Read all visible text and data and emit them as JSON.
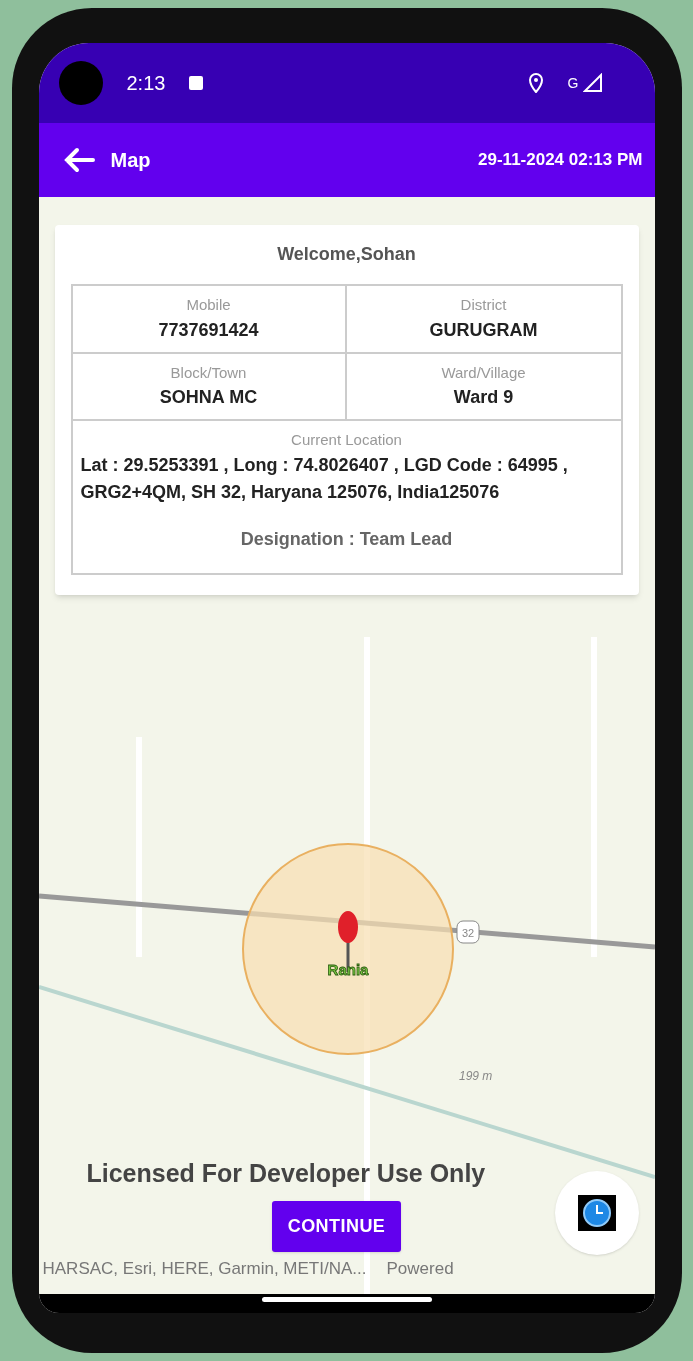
{
  "status_bar": {
    "time": "2:13",
    "network": "G"
  },
  "app_bar": {
    "title": "Map",
    "datetime": "29-11-2024 02:13 PM"
  },
  "card": {
    "welcome": "Welcome,Sohan",
    "fields": [
      {
        "label": "Mobile",
        "value": "7737691424"
      },
      {
        "label": "District",
        "value": "GURUGRAM"
      },
      {
        "label": "Block/Town",
        "value": "SOHNA MC"
      },
      {
        "label": "Ward/Village",
        "value": "Ward 9"
      }
    ],
    "location": {
      "label": "Current Location",
      "value": "Lat : 29.5253391 , Long : 74.8026407 , LGD Code : 64995 , GRG2+4QM, SH 32, Haryana 125076, India125076"
    },
    "designation": "Designation : Team Lead"
  },
  "map": {
    "place_label": "Rania",
    "road_shield": "32",
    "scale": "199 m",
    "license": "Licensed For Developer Use Only",
    "attribution": "HARSAC, Esri, HERE, Garmin, METI/NA...",
    "powered": "Powered"
  },
  "continue_button": "CONTINUE"
}
